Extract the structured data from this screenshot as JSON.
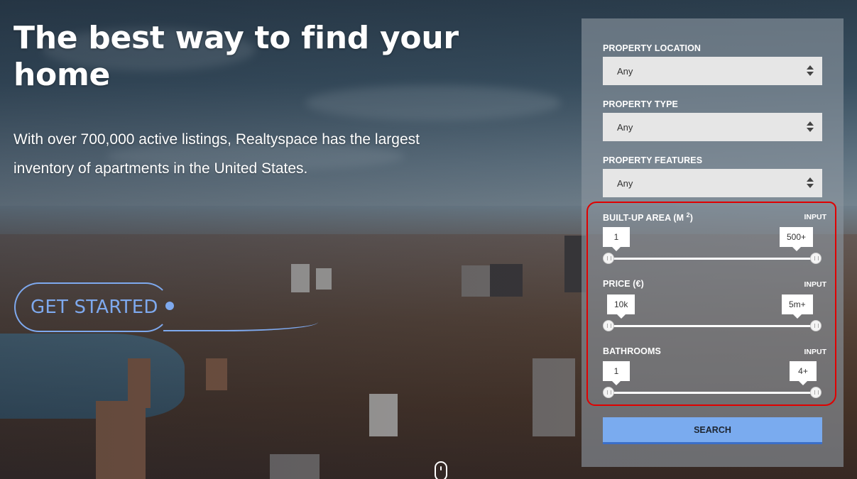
{
  "hero": {
    "title": "The best way to find your home",
    "subtitle": "With over 700,000 active listings, Realtyspace has the largest inventory of apartments in the United States.",
    "cta_label": "GET STARTED"
  },
  "search_panel": {
    "location": {
      "label": "PROPERTY LOCATION",
      "value": "Any"
    },
    "type": {
      "label": "PROPERTY TYPE",
      "value": "Any"
    },
    "features": {
      "label": "PROPERTY FEATURES",
      "value": "Any"
    },
    "area": {
      "label": "BUILT-UP AREA (M",
      "label_sup": "2",
      "label_close": ")",
      "input_label": "INPUT",
      "min_display": "1",
      "max_display": "500+",
      "range_fraction": [
        0,
        1
      ]
    },
    "price": {
      "label": "PRICE (€)",
      "input_label": "INPUT",
      "min_display": "10k",
      "max_display": "5m+",
      "range_fraction": [
        0,
        1
      ]
    },
    "bathrooms": {
      "label": "BATHROOMS",
      "input_label": "INPUT",
      "min_display": "1",
      "max_display": "4+",
      "range_fraction": [
        0,
        1
      ]
    },
    "search_label": "SEARCH"
  },
  "colors": {
    "accent": "#7aabef",
    "accent_dark": "#3b6fc9",
    "cta": "#7ea9ee",
    "annotation": "#e00000"
  },
  "icons": {
    "scroll_indicator": "mouse-icon",
    "select_arrows": "sort-arrows-icon",
    "slider_handle": "grip-handle-icon"
  }
}
